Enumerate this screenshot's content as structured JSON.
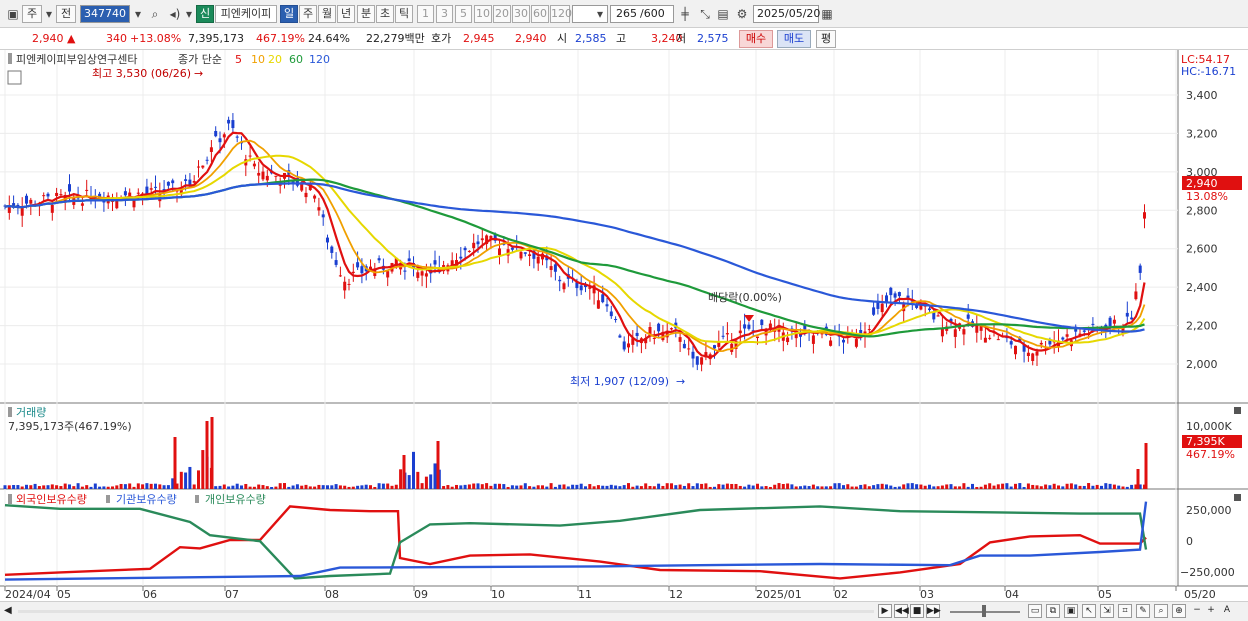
{
  "toolbar": {
    "market": "주",
    "mode": "전",
    "code": "347740",
    "name_tag": "신",
    "name": "피엔케이피",
    "periods": [
      "일",
      "주",
      "월",
      "년",
      "분",
      "초",
      "틱"
    ],
    "selected_period": "일",
    "ticks": [
      "1",
      "3",
      "5",
      "10",
      "20",
      "30",
      "60",
      "120"
    ],
    "count": "265",
    "count_total": "/600",
    "date": "2025/05/20"
  },
  "quote": {
    "price": "2,940",
    "arrow": "▲",
    "change": "340",
    "change_pct": "+13.08%",
    "volume": "7,395,173",
    "volume_ratio": "467.19%",
    "turnover": "24.64%",
    "amount": "22,279백만",
    "bid_label": "호가",
    "ask": "2,945",
    "bid": "2,940",
    "open_label": "시",
    "open": "2,585",
    "high_label": "고",
    "high": "3,240",
    "low_label": "저",
    "low": "2,575",
    "buy_label": "매수",
    "sell_label": "매도",
    "eval_label": "평"
  },
  "price_panel": {
    "title": "피엔케이피부임상연구센타",
    "legend_prefix": "종가 단순",
    "ma": [
      {
        "label": "5",
        "color": "#e01010"
      },
      {
        "label": "10",
        "color": "#f0a000"
      },
      {
        "label": "20",
        "color": "#e6d800"
      },
      {
        "label": "60",
        "color": "#1e9a3a"
      },
      {
        "label": "120",
        "color": "#2a58d8"
      }
    ],
    "lc": "LC:54.17",
    "hc": "HC:-16.71",
    "y_ticks": [
      "3,400",
      "3,200",
      "3,000",
      "2,800",
      "2,600",
      "2,400",
      "2,200",
      "2,000"
    ],
    "last_price": "2,940",
    "last_pct": "13.08%",
    "high_note": "최고 3,530 (06/26)",
    "low_note": "최저 1,907 (12/09)",
    "dividend_note": "배당락(0.00%)"
  },
  "volume_panel": {
    "title": "거래량",
    "value": "7,395,173주(467.19%)",
    "y_tick": "10,000K",
    "last": "7,395K",
    "last_pct": "467.19%"
  },
  "holdings_panel": {
    "legend": [
      {
        "label": "외국인보유수량",
        "color": "#e01010"
      },
      {
        "label": "기관보유수량",
        "color": "#2a58d8"
      },
      {
        "label": "개인보유수량",
        "color": "#2a8a5a"
      }
    ],
    "y_ticks": [
      "250,000",
      "0",
      "−250,000"
    ]
  },
  "x_axis": [
    "2024/04",
    "05",
    "06",
    "07",
    "08",
    "09",
    "10",
    "11",
    "12",
    "2025/01",
    "02",
    "03",
    "04",
    "05",
    "05/20"
  ]
}
